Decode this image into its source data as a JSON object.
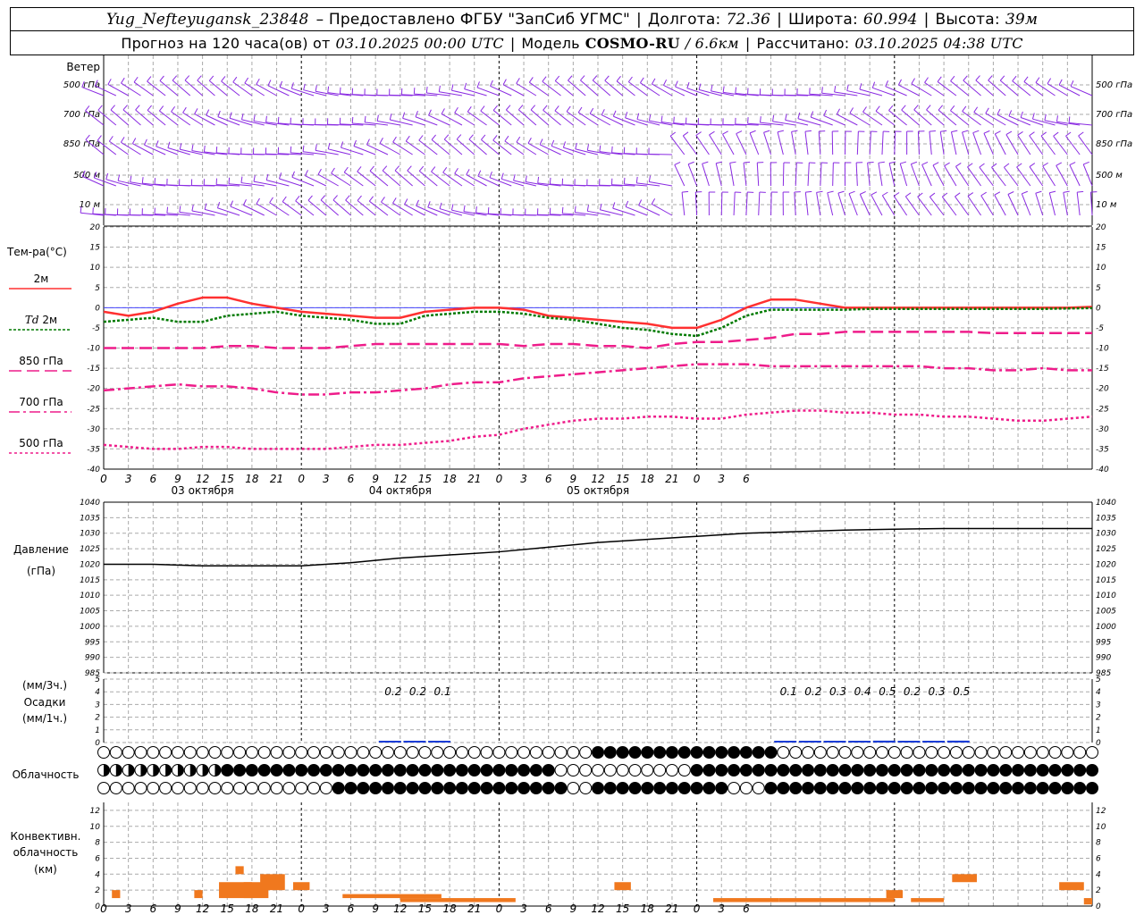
{
  "header": {
    "station": "Yug_Nefteyugansk_23848",
    "provided": "– Предоставлено ФГБУ \"ЗапСиб УГМС\"",
    "lon_label": "Долгота:",
    "lon": "72.36",
    "lat_label": "Широта:",
    "lat": "60.994",
    "alt_label": "Высота:",
    "alt": "39м",
    "forecast_prefix": "Прогноз на 120 часа(ов) от",
    "forecast_start": "03.10.2025 00:00 UTC",
    "model_label": "Модель",
    "model": "COSMO-RU",
    "model_res": "/ 6.6км",
    "calc_label": "Рассчитано:",
    "calc_time": "03.10.2025 04:38 UTC"
  },
  "labels": {
    "wind": "Ветер",
    "wind_levels": [
      "500 гПа",
      "700 гПа",
      "850 гПа",
      "500 м",
      "10 м"
    ],
    "temp": "Тем-ра(°С)",
    "t2m": "2м",
    "td": "Td",
    "td2m": "2м",
    "t850": "850 гПа",
    "t700": "700 гПа",
    "t500": "500 гПа",
    "pressure": "Давление",
    "pressure_unit": "(гПа)",
    "precip_unit3": "(мм/3ч.)",
    "precip": "Осадки",
    "precip_unit1": "(мм/1ч.)",
    "cloud": "Облачность",
    "conv1": "Конвективн.",
    "conv2": "облачность",
    "conv3": "(км)"
  },
  "colors": {
    "wind": "#8a2be2",
    "t2m": "#ff3030",
    "td": "#007a00",
    "upper": "#ee1c8a",
    "zero": "#4444ff",
    "precip": "#1a3cd6",
    "precip2": "#22aa22",
    "conv": "#f0781e",
    "grid": "#aaaaaa"
  },
  "chart_data": [
    {
      "type": "line",
      "name": "temperature",
      "x_hours_ticks": [
        "0",
        "3",
        "6",
        "9",
        "12",
        "15",
        "18",
        "21",
        "0",
        "3",
        "6",
        "9",
        "12",
        "15",
        "18",
        "21",
        "0",
        "3",
        "6",
        "9",
        "12",
        "15",
        "18",
        "21",
        "0",
        "3",
        "6"
      ],
      "date_labels": [
        "03 октября",
        "04 октября",
        "05 октября"
      ],
      "ylim": [
        -40,
        20
      ],
      "yticks": [
        20,
        15,
        10,
        5,
        0,
        -5,
        -10,
        -15,
        -20,
        -25,
        -30,
        -35,
        -40
      ],
      "x": [
        0,
        3,
        6,
        9,
        12,
        15,
        18,
        21,
        24,
        27,
        30,
        33,
        36,
        39,
        42,
        45,
        48,
        51,
        54,
        57,
        60,
        63,
        66,
        69,
        72,
        75,
        78,
        81,
        84,
        87,
        90,
        93,
        96,
        99,
        102,
        105,
        108,
        111,
        114,
        117,
        120
      ],
      "series": [
        {
          "name": "2м",
          "values": [
            -1,
            -2,
            -1,
            1,
            2.5,
            2.5,
            1,
            0,
            -1,
            -1.5,
            -2,
            -2.5,
            -2.5,
            -1,
            -0.5,
            0,
            0,
            -0.5,
            -2,
            -2.5,
            -3,
            -3.5,
            -4,
            -5,
            -5,
            -3,
            0,
            2,
            2,
            1,
            0,
            0,
            0,
            0,
            0,
            0,
            0,
            0,
            0,
            0,
            0.2
          ]
        },
        {
          "name": "Td 2м",
          "values": [
            -3.5,
            -3,
            -2.5,
            -3.5,
            -3.5,
            -2,
            -1.5,
            -1,
            -2,
            -2.5,
            -3,
            -4,
            -4,
            -2,
            -1.5,
            -1,
            -1,
            -1.5,
            -2.5,
            -3,
            -4,
            -5,
            -5.5,
            -6.5,
            -7,
            -5,
            -2,
            -0.5,
            -0.5,
            -0.5,
            -0.5,
            -0.3,
            -0.3,
            -0.3,
            -0.3,
            -0.3,
            -0.3,
            -0.3,
            -0.3,
            -0.2,
            -0.1
          ]
        },
        {
          "name": "850 гПа",
          "values": [
            -10,
            -10,
            -10,
            -10,
            -10,
            -9.5,
            -9.5,
            -10,
            -10,
            -10,
            -9.5,
            -9,
            -9,
            -9,
            -9,
            -9,
            -9,
            -9.5,
            -9,
            -9,
            -9.5,
            -9.5,
            -10,
            -9,
            -8.5,
            -8.5,
            -8,
            -7.5,
            -6.5,
            -6.5,
            -6,
            -6,
            -6,
            -6,
            -6,
            -6,
            -6.3,
            -6.3,
            -6.3,
            -6.3,
            -6.3
          ]
        },
        {
          "name": "700 гПа",
          "values": [
            -20.5,
            -20,
            -19.5,
            -19,
            -19.5,
            -19.5,
            -20,
            -21,
            -21.5,
            -21.5,
            -21,
            -21,
            -20.5,
            -20,
            -19,
            -18.5,
            -18.5,
            -17.5,
            -17,
            -16.5,
            -16,
            -15.5,
            -15,
            -14.5,
            -14,
            -14,
            -14,
            -14.5,
            -14.5,
            -14.5,
            -14.5,
            -14.5,
            -14.5,
            -14.5,
            -15,
            -15,
            -15.5,
            -15.5,
            -15,
            -15.5,
            -15.5
          ]
        },
        {
          "name": "500 гПа",
          "values": [
            -34,
            -34.5,
            -35,
            -35,
            -34.5,
            -34.5,
            -35,
            -35,
            -35,
            -35,
            -34.5,
            -34,
            -34,
            -33.5,
            -33,
            -32,
            -31.5,
            -30,
            -29,
            -28,
            -27.5,
            -27.5,
            -27,
            -27,
            -27.5,
            -27.5,
            -26.5,
            -26,
            -25.5,
            -25.5,
            -26,
            -26,
            -26.5,
            -26.5,
            -27,
            -27,
            -27.5,
            -28,
            -28,
            -27.5,
            -27
          ]
        }
      ]
    },
    {
      "type": "line",
      "name": "pressure",
      "ylim": [
        985,
        1040
      ],
      "yticks": [
        1040,
        1035,
        1030,
        1025,
        1020,
        1015,
        1010,
        1005,
        1000,
        995,
        990,
        985
      ],
      "x": [
        0,
        6,
        12,
        18,
        24,
        30,
        36,
        42,
        48,
        54,
        60,
        66,
        72,
        78,
        84,
        90,
        96,
        102,
        108,
        114,
        120
      ],
      "values": [
        1020,
        1020,
        1019.5,
        1019.5,
        1019.5,
        1020.5,
        1022,
        1023,
        1024,
        1025.5,
        1027,
        1028,
        1029,
        1030,
        1030.5,
        1031,
        1031.3,
        1031.5,
        1031.5,
        1031.5,
        1031.5
      ]
    },
    {
      "type": "bar",
      "name": "precipitation",
      "ylim": [
        0,
        5
      ],
      "yticks": [
        5,
        4,
        3,
        2,
        1,
        0
      ],
      "labels_3h": [
        {
          "hour": 36,
          "text": "0.2"
        },
        {
          "hour": 39,
          "text": "0.2"
        },
        {
          "hour": 42,
          "text": "0.1"
        },
        {
          "hour": 84,
          "text": "0.1"
        },
        {
          "hour": 87,
          "text": "0.2"
        },
        {
          "hour": 90,
          "text": "0.3"
        },
        {
          "hour": 93,
          "text": "0.4"
        },
        {
          "hour": 96,
          "text": "0.5"
        },
        {
          "hour": 99,
          "text": "0.2"
        },
        {
          "hour": 102,
          "text": "0.3"
        },
        {
          "hour": 105,
          "text": "0.5"
        }
      ]
    },
    {
      "type": "bar",
      "name": "convective_cloud",
      "ylim": [
        0,
        13
      ],
      "yticks": [
        12,
        10,
        8,
        6,
        4,
        2,
        0
      ]
    }
  ]
}
